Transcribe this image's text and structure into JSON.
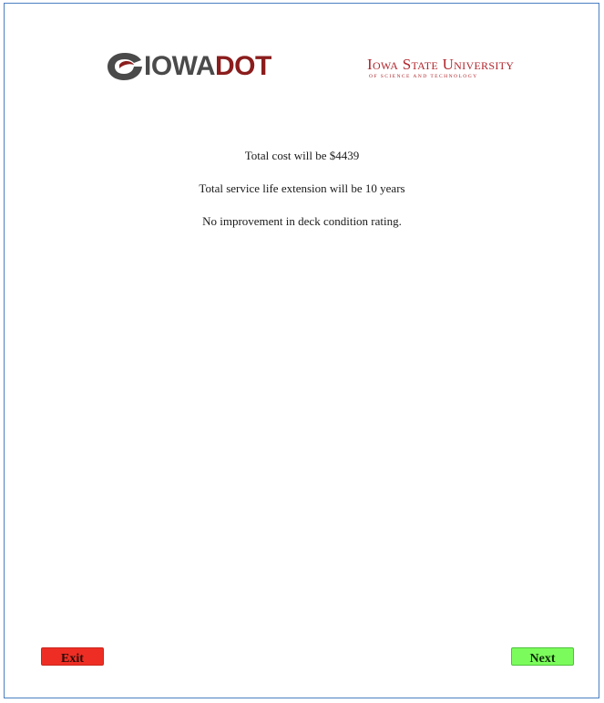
{
  "logos": {
    "iowadot": {
      "part1": "IOWA",
      "part2": "DOT"
    },
    "isu": {
      "name": "Iowa State University",
      "subtitle": "of Science and Technology"
    }
  },
  "messages": {
    "cost": "Total cost will be $4439",
    "service_life": "Total service life extension will be 10 years",
    "deck_rating": "No improvement in deck condition rating."
  },
  "buttons": {
    "exit_label": "Exit",
    "next_label": "Next"
  },
  "colors": {
    "exit_button": "#ee2e24",
    "next_button": "#7cfc5c",
    "dot_red": "#8b1d1d",
    "isu_red": "#b0262c"
  }
}
